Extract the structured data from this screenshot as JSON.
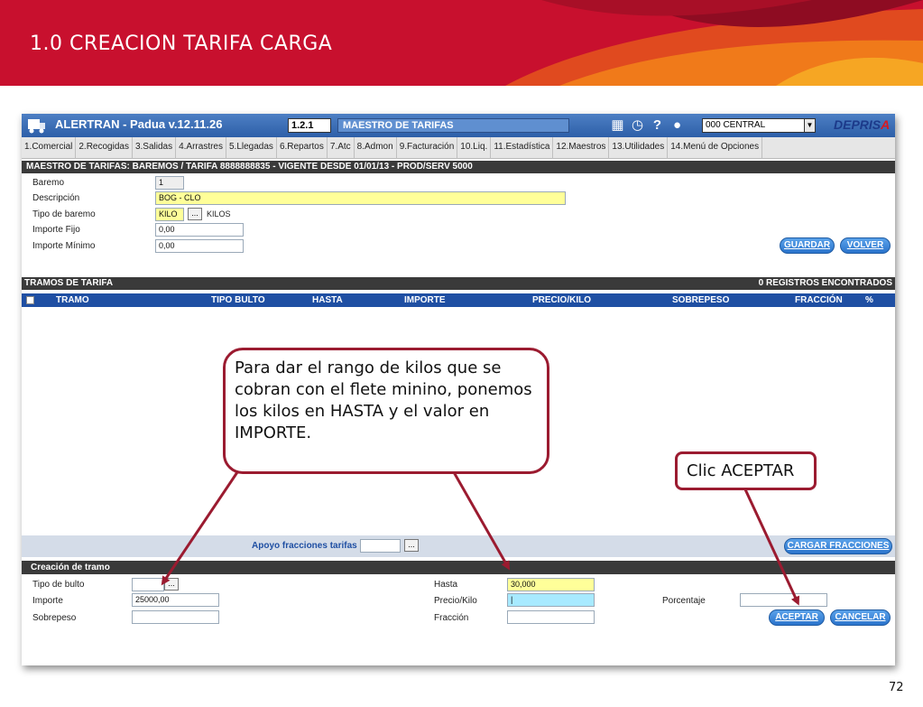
{
  "slide": {
    "title": "1.0 CREACION TARIFA CARGA",
    "page_number": "72",
    "colors": {
      "header": "#c8102e",
      "callout_border": "#9b1b30",
      "app_blue": "#1f4fa3"
    }
  },
  "app": {
    "title": "ALERTRAN - Padua  v.12.11.26",
    "code": "1.2.1",
    "module": "MAESTRO DE TARIFAS",
    "office": "000 CENTRAL",
    "brand_main": "DEPRIS",
    "brand_accent": "A",
    "toolbar_icons": [
      "calendar-icon",
      "clock-icon",
      "help-icon",
      "user-icon"
    ],
    "menu": [
      "1.Comercial",
      "2.Recogidas",
      "3.Salidas",
      "4.Arrastres",
      "5.Llegadas",
      "6.Repartos",
      "7.Atc",
      "8.Admon",
      "9.Facturación",
      "10.Liq.",
      "11.Estadística",
      "12.Maestros",
      "13.Utilidades",
      "14.Menú de Opciones"
    ],
    "header_bar": "MAESTRO DE TARIFAS: BAREMOS   /   TARIFA 8888888835   -   VIGENTE DESDE 01/01/13   -   PROD/SERV 5000",
    "baremo_form": {
      "baremo_label": "Baremo",
      "baremo_value": "1",
      "descripcion_label": "Descripción",
      "descripcion_value": "BOG - CLO",
      "tipo_label": "Tipo de baremo",
      "tipo_value": "KILO",
      "tipo_desc": "KILOS",
      "importe_fijo_label": "Importe Fijo",
      "importe_fijo_value": "0,00",
      "importe_minimo_label": "Importe Mínimo",
      "importe_minimo_value": "0,00",
      "lookup_label": "...",
      "guardar_label": "GUARDAR",
      "volver_label": "VOLVER"
    },
    "tramos": {
      "title": "TRAMOS DE TARIFA",
      "count": "0 REGISTROS ENCONTRADOS",
      "columns": [
        "TRAMO",
        "TIPO BULTO",
        "HASTA",
        "IMPORTE",
        "PRECIO/KILO",
        "SOBREPESO",
        "FRACCIÓN",
        "%"
      ]
    },
    "apoyo": {
      "label": "Apoyo fracciones tarifas",
      "value": "",
      "lookup_label": "...",
      "cargar_label": "CARGAR FRACCIONES"
    },
    "creacion": {
      "title": "Creación de tramo",
      "tipo_bulto_label": "Tipo de bulto",
      "tipo_bulto_value": "",
      "importe_label": "Importe",
      "importe_value": "25000,00",
      "sobrepeso_label": "Sobrepeso",
      "sobrepeso_value": "",
      "hasta_label": "Hasta",
      "hasta_value": "30,000",
      "precio_kilo_label": "Precio/Kilo",
      "precio_kilo_value": "|",
      "fraccion_label": "Fracción",
      "fraccion_value": "",
      "porcentaje_label": "Porcentaje",
      "porcentaje_value": "",
      "lookup_label": "...",
      "aceptar_label": "ACEPTAR",
      "cancelar_label": "CANCELAR"
    }
  },
  "callouts": {
    "range_note": "Para dar el rango de kilos que se cobran con el flete minino, ponemos  los kilos en HASTA y el valor en IMPORTE.",
    "click_note": "Clic ACEPTAR"
  }
}
